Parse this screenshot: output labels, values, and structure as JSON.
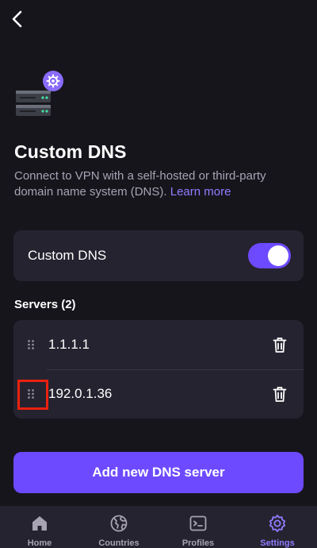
{
  "header": {
    "back_icon": "chevron-left-icon",
    "hero_icon": "server-gear-icon"
  },
  "page": {
    "title": "Custom DNS",
    "description": "Connect to VPN with a self-hosted or third-party domain name system (DNS).",
    "learn_more": "Learn more"
  },
  "custom_dns_toggle": {
    "label": "Custom DNS",
    "enabled": true
  },
  "servers": {
    "heading": "Servers (2)",
    "items": [
      {
        "address": "1.1.1.1"
      },
      {
        "address": "192.0.1.36"
      }
    ]
  },
  "add_button": {
    "label": "Add new DNS server"
  },
  "tab_bar": {
    "tabs": [
      {
        "label": "Home",
        "icon": "home-icon",
        "active": false
      },
      {
        "label": "Countries",
        "icon": "globe-icon",
        "active": false
      },
      {
        "label": "Profiles",
        "icon": "terminal-icon",
        "active": false
      },
      {
        "label": "Settings",
        "icon": "gear-icon",
        "active": true
      }
    ]
  },
  "colors": {
    "background": "#17151c",
    "card": "#262330",
    "accent": "#6d4aff",
    "link": "#8f7dff",
    "muted_text": "#a7a3b3",
    "highlight": "#e8210f"
  }
}
